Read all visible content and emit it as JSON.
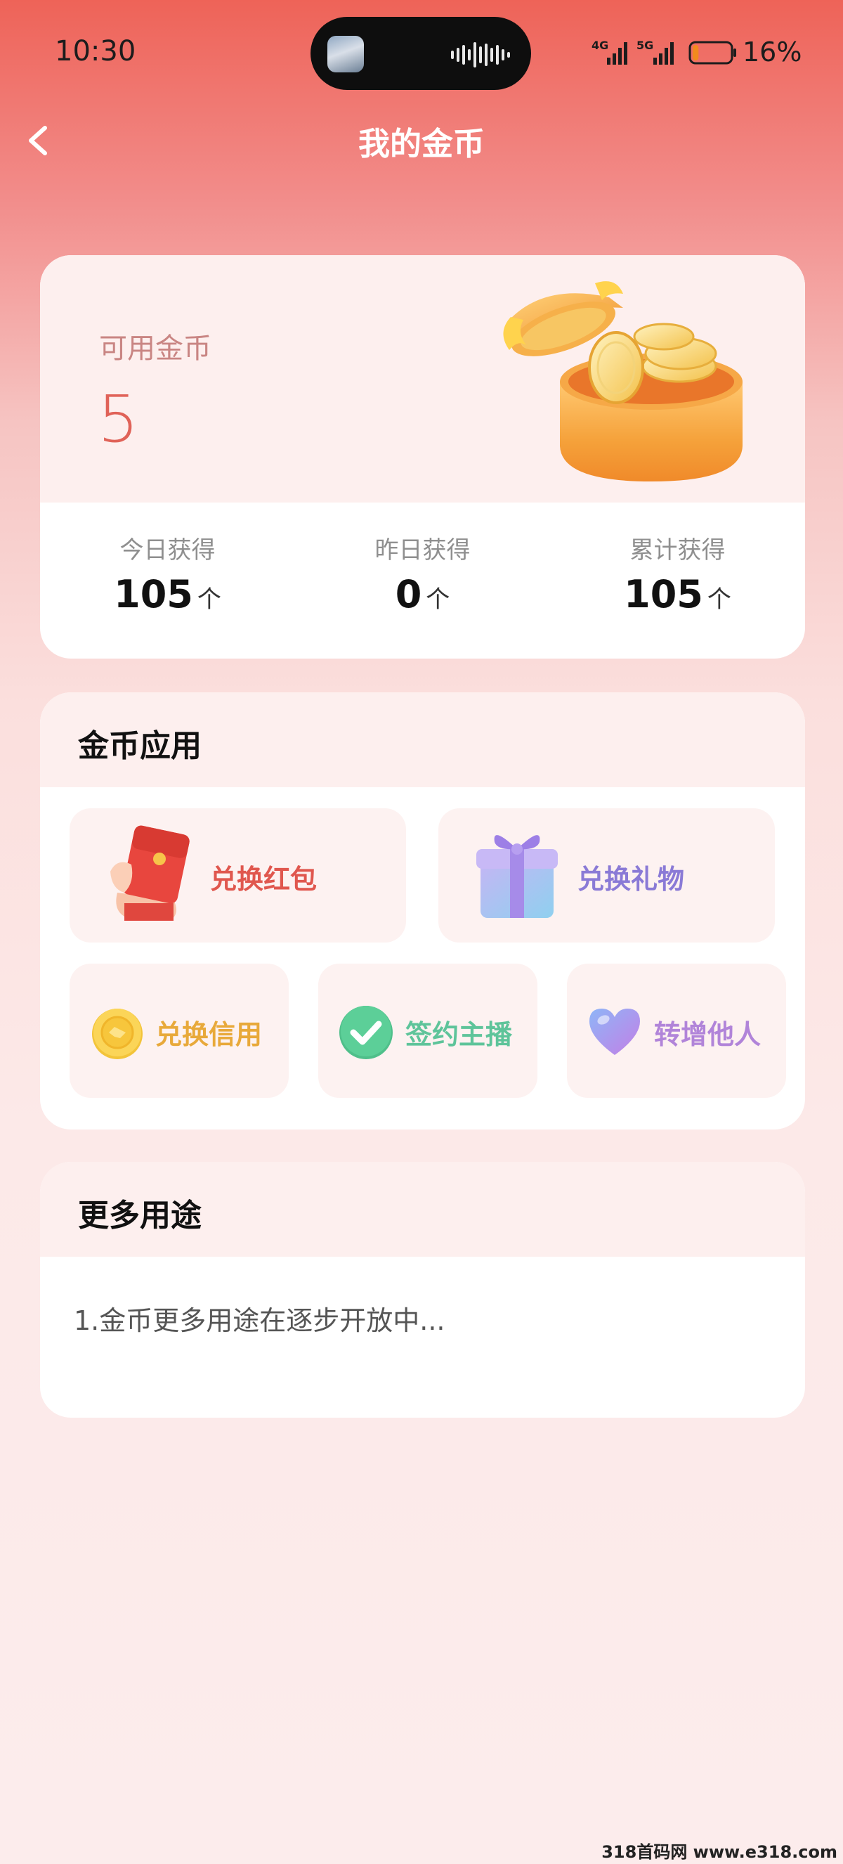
{
  "status_bar": {
    "time": "10:30",
    "network_1": "4G",
    "network_2": "5G",
    "battery_level": 0.16,
    "battery_text": "16%",
    "island_icons": [
      "media-thumbnail",
      "audio-waveform"
    ]
  },
  "header": {
    "title": "我的金币",
    "back_icon": "chevron-left-icon"
  },
  "coin_summary": {
    "available_label": "可用金币",
    "available_value": "5",
    "illustration": "gold-coin-treasure-box",
    "stats": [
      {
        "label": "今日获得",
        "value": "105",
        "unit": "个"
      },
      {
        "label": "昨日获得",
        "value": "0",
        "unit": "个"
      },
      {
        "label": "累计获得",
        "value": "105",
        "unit": "个"
      }
    ]
  },
  "coin_apps": {
    "title": "金币应用",
    "items": [
      {
        "label": "兑换红包",
        "icon": "red-envelope-icon",
        "color": "#e0574e"
      },
      {
        "label": "兑换礼物",
        "icon": "gift-box-icon",
        "color": "#8a7ad6"
      },
      {
        "label": "兑换信用",
        "icon": "gold-coin-icon",
        "color": "#e8a93a"
      },
      {
        "label": "签约主播",
        "icon": "check-circle-icon",
        "color": "#5ec49a"
      },
      {
        "label": "转增他人",
        "icon": "heart-icon",
        "color": "#b184d9"
      }
    ]
  },
  "more_uses": {
    "title": "更多用途",
    "text": "1.金币更多用途在逐步开放中..."
  },
  "watermark": "318首码网 www.e318.com",
  "colors": {
    "header_top": "#ee6358",
    "accent_red": "#e06258",
    "card_tint": "#fdefee"
  }
}
